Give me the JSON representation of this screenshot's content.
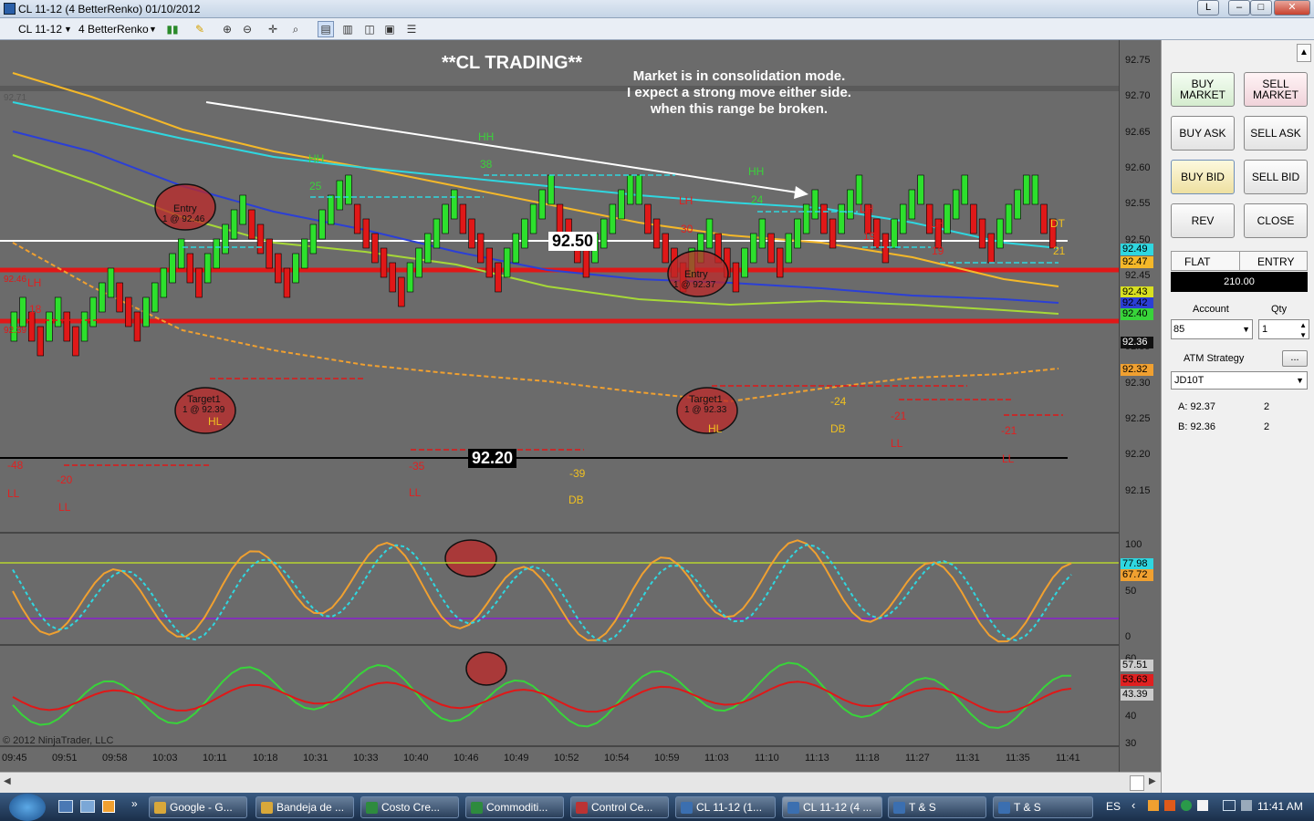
{
  "window": {
    "title": "CL 11-12 (4 BetterRenko)  01/10/2012",
    "lang_button": "L",
    "minimize": "–",
    "maximize": "□",
    "close": "✕"
  },
  "toolbar": {
    "instrument": "CL 11-12",
    "bar_type": "4 BetterRenko"
  },
  "chart": {
    "title": "**CL TRADING**",
    "commentary": [
      "Market is in consolidation mode.",
      "I expect a strong move either side.",
      "when this range be broken."
    ],
    "level_high": "92.50",
    "level_low": "92.20",
    "copyright": "© 2012 NinjaTrader, LLC",
    "y_ticks": [
      "92.75",
      "92.70",
      "92.65",
      "92.60",
      "92.55",
      "92.50",
      "92.45",
      "92.40",
      "92.35",
      "92.30",
      "92.25",
      "92.20",
      "92.15"
    ],
    "price_tags": [
      {
        "label": "92.49",
        "color": "#2fd7e0"
      },
      {
        "label": "92.47",
        "color": "#f5b829"
      },
      {
        "label": "92.43",
        "color": "#d8e020"
      },
      {
        "label": "92.42",
        "color": "#2b3fd6"
      },
      {
        "label": "92.40",
        "color": "#38d43a"
      },
      {
        "label": "92.36",
        "color": "#111111"
      },
      {
        "label": "92.32",
        "color": "#f0a030"
      }
    ],
    "x_ticks": [
      "09:45",
      "09:51",
      "09:58",
      "10:03",
      "10:11",
      "10:18",
      "10:31",
      "10:33",
      "10:40",
      "10:46",
      "10:49",
      "10:52",
      "10:54",
      "10:59",
      "11:03",
      "11:10",
      "11:13",
      "11:18",
      "11:27",
      "11:31",
      "11:35",
      "11:41"
    ],
    "annotations": {
      "entry1": "Entry",
      "entry1_detail": "1 @ 92.46",
      "target1": "Target1",
      "target1_detail": "1 @ 92.39",
      "entry2": "Entry",
      "entry2_detail": "1 @ 92.37",
      "target2": "Target1",
      "target2_detail": "1 @ 92.33"
    },
    "swing_labels": [
      {
        "text": "HH",
        "color": "#3ad33a"
      },
      {
        "text": "38",
        "color": "#3ad33a"
      },
      {
        "text": "HH",
        "color": "#3ad33a"
      },
      {
        "text": "24",
        "color": "#3ad33a"
      },
      {
        "text": "25",
        "color": "#3ad33a"
      },
      {
        "text": "HH",
        "color": "#3ad33a"
      },
      {
        "text": "LH",
        "color": "#e02020"
      },
      {
        "text": "30",
        "color": "#e02020"
      },
      {
        "text": "LH",
        "color": "#e02020"
      },
      {
        "text": "LH",
        "color": "#e02020"
      },
      {
        "text": "19",
        "color": "#e02020"
      },
      {
        "text": "19",
        "color": "#e02020"
      },
      {
        "text": "DT",
        "color": "#f0c020"
      },
      {
        "text": "21",
        "color": "#f0c020"
      },
      {
        "text": "18",
        "color": "#e02020"
      },
      {
        "text": "LH",
        "color": "#e02020"
      },
      {
        "text": "-48",
        "color": "#e02020"
      },
      {
        "text": "LL",
        "color": "#e02020"
      },
      {
        "text": "-20",
        "color": "#e02020"
      },
      {
        "text": "LL",
        "color": "#e02020"
      },
      {
        "text": "-35",
        "color": "#e02020"
      },
      {
        "text": "LL",
        "color": "#e02020"
      },
      {
        "text": "-39",
        "color": "#f0c020"
      },
      {
        "text": "DB",
        "color": "#f0c020"
      },
      {
        "text": "-24",
        "color": "#f0c020"
      },
      {
        "text": "DB",
        "color": "#f0c020"
      },
      {
        "text": "-21",
        "color": "#e02020"
      },
      {
        "text": "LL",
        "color": "#e02020"
      },
      {
        "text": "-21",
        "color": "#e02020"
      },
      {
        "text": "LL",
        "color": "#e02020"
      },
      {
        "text": "HL",
        "color": "#f0c020"
      },
      {
        "text": "HL",
        "color": "#f0c020"
      }
    ],
    "left_labels": [
      "92.71",
      "92.46",
      "92.39"
    ],
    "stoch_ticks": [
      "100",
      "50",
      "0"
    ],
    "stoch_tags": [
      {
        "label": "77.98",
        "color": "#2fd7e0"
      },
      {
        "label": "67.72",
        "color": "#f0a030"
      }
    ],
    "osc_ticks": [
      "60",
      "40",
      "30"
    ],
    "osc_tags": [
      {
        "label": "57.51",
        "color": "#cccccc"
      },
      {
        "label": "53.63",
        "color": "#e02020"
      },
      {
        "label": "43.39",
        "color": "#cccccc"
      }
    ]
  },
  "panel": {
    "buy_market": "BUY\nMARKET",
    "sell_market": "SELL\nMARKET",
    "buy_ask": "BUY ASK",
    "sell_ask": "SELL ASK",
    "buy_bid": "BUY BID",
    "sell_bid": "SELL BID",
    "rev": "REV",
    "close": "CLOSE",
    "flat": "FLAT",
    "entry": "ENTRY",
    "pnl": "210.00",
    "account_label": "Account",
    "account_value": "85",
    "qty_label": "Qty",
    "qty_value": "1",
    "atm_label": "ATM Strategy",
    "atm_more": "...",
    "atm_value": "JD10T",
    "ask_label": "A: 92.37",
    "ask_size": "2",
    "bid_label": "B: 92.36",
    "bid_size": "2"
  },
  "taskbar": {
    "items": [
      "Google - G...",
      "Bandeja de ...",
      "Costo Cre...",
      "Commoditi...",
      "Control Ce...",
      "CL 11-12 (1...",
      "CL 11-12 (4 ...",
      "T & S",
      "T & S"
    ],
    "lang": "ES",
    "clock": "11:41 AM"
  }
}
